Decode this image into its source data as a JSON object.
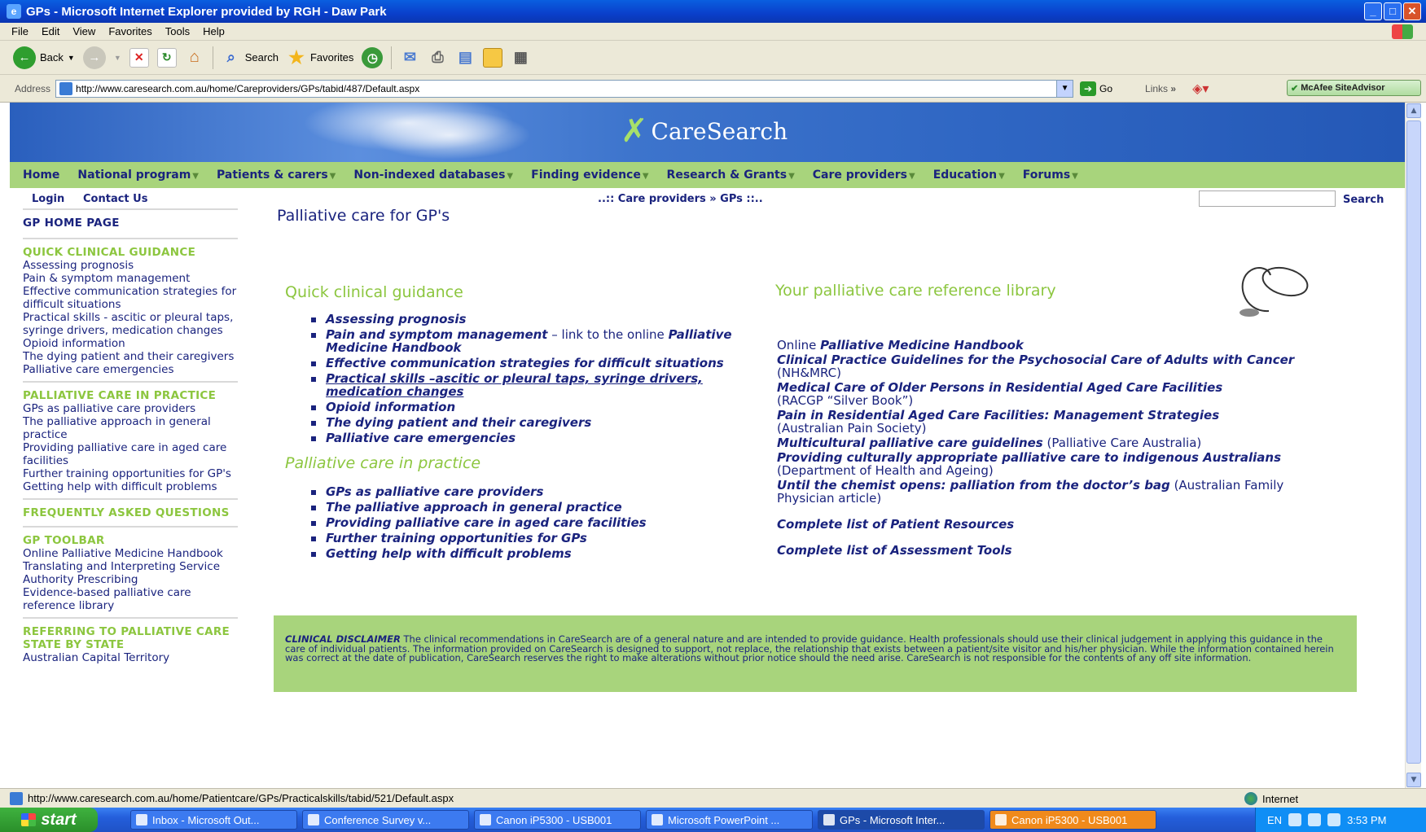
{
  "window": {
    "title": "GPs - Microsoft Internet Explorer provided by RGH - Daw Park"
  },
  "menu": [
    "File",
    "Edit",
    "View",
    "Favorites",
    "Tools",
    "Help"
  ],
  "toolbar": {
    "back": "Back",
    "search": "Search",
    "favorites": "Favorites"
  },
  "address": {
    "label": "Address",
    "url": "http://www.caresearch.com.au/home/Careproviders/GPs/tabid/487/Default.aspx",
    "go": "Go",
    "links": "Links",
    "mcafee": "McAfee SiteAdvisor"
  },
  "site": {
    "logo": "CareSearch",
    "nav": [
      "Home",
      "National program",
      "Patients & carers",
      "Non-indexed databases",
      "Finding evidence",
      "Research & Grants",
      "Care providers",
      "Education",
      "Forums"
    ],
    "login": "Login",
    "contact": "Contact Us",
    "breadcrumb": "..:: Care providers » GPs ::..",
    "search_btn": "Search"
  },
  "sidebar": {
    "home": "GP HOME PAGE",
    "sections": [
      {
        "title": "QUICK CLINICAL GUIDANCE",
        "links": [
          "Assessing prognosis",
          "Pain & symptom management",
          "Effective communication strategies for difficult situations",
          "Practical skills - ascitic or pleural taps, syringe drivers, medication changes",
          "Opioid information",
          "The dying patient and their caregivers",
          "Palliative care emergencies"
        ]
      },
      {
        "title": "PALLIATIVE CARE IN PRACTICE",
        "links": [
          "GPs as palliative care providers",
          "The palliative approach in general practice",
          "Providing palliative care in aged care facilities",
          "Further training opportunities for GP's",
          "Getting help with difficult problems"
        ]
      },
      {
        "title": "FREQUENTLY ASKED QUESTIONS",
        "links": []
      },
      {
        "title": "GP TOOLBAR",
        "links": [
          "Online Palliative Medicine Handbook",
          "Translating and Interpreting Service",
          "Authority Prescribing",
          "Evidence-based palliative care reference library"
        ]
      },
      {
        "title": "REFERRING TO PALLIATIVE CARE STATE BY STATE",
        "links": [
          "Australian Capital Territory"
        ]
      }
    ]
  },
  "main": {
    "title": "Palliative care for GP's",
    "qcg_heading": "Quick clinical guidance",
    "qcg": {
      "i0": "Assessing prognosis",
      "i1a": "Pain and symptom management",
      "i1b": " – link to the online ",
      "i1c": "Palliative Medicine Handbook",
      "i2": "Effective communication strategies for difficult situations",
      "i3": "Practical skills –ascitic or pleural taps, syringe drivers, medication changes",
      "i4": "Opioid information",
      "i5": "The dying patient and their caregivers",
      "i6": "Palliative care emergencies"
    },
    "pcp_heading": "Palliative care in practice",
    "pcp": [
      "GPs as palliative care providers",
      "The palliative approach in general practice",
      "Providing palliative care in aged care facilities",
      "Further training opportunities for GPs",
      "Getting help with difficult problems"
    ],
    "ref_heading": "Your palliative care reference library",
    "ref": {
      "r0a": "Online ",
      "r0b": "Palliative Medicine Handbook",
      "r1a": "Clinical Practice Guidelines for the Psychosocial Care of Adults with Cancer",
      "r1b": " (NH&MRC)",
      "r2a": "Medical Care of Older Persons in Residential Aged Care Facilities",
      "r2b": "(RACGP “Silver Book”)",
      "r3a": "Pain in Residential Aged Care Facilities: Management Strategies",
      "r3b": " (Australian Pain Society)",
      "r4a": "Multicultural palliative care guidelines",
      "r4b": " (Palliative Care Australia)",
      "r5a": "Providing culturally appropriate palliative care to indigenous Australians",
      "r5b": "  (Department of Health and Ageing)",
      "r6a": "Until the chemist opens: palliation from the doctor’s bag",
      "r6b": " (Australian Family Physician article)",
      "r7": "Complete list of Patient Resources",
      "r8": "Complete list of Assessment Tools"
    },
    "disclaimer_title": "CLINICAL DISCLAIMER",
    "disclaimer_text": "  The clinical recommendations in CareSearch are of a general nature and are intended to provide guidance.  Health professionals should use their clinical judgement in applying this guidance in the care of individual patients. The information provided on CareSearch is designed to support, not replace, the relationship that exists between a patient/site visitor and his/her physician.  While the information contained herein was correct at the date of publication, CareSearch reserves the right to make alterations without prior notice should the need arise.  CareSearch is not responsible for the contents of any off site information."
  },
  "status": {
    "url": "http://www.caresearch.com.au/home/Patientcare/GPs/Practicalskills/tabid/521/Default.aspx",
    "zone": "Internet"
  },
  "taskbar": {
    "start": "start",
    "tasks": [
      "Inbox - Microsoft Out...",
      "Conference Survey v...",
      "Canon iP5300 - USB001",
      "Microsoft PowerPoint ...",
      "GPs - Microsoft Inter...",
      "Canon iP5300 - USB001"
    ],
    "lang": "EN",
    "time": "3:53 PM"
  }
}
